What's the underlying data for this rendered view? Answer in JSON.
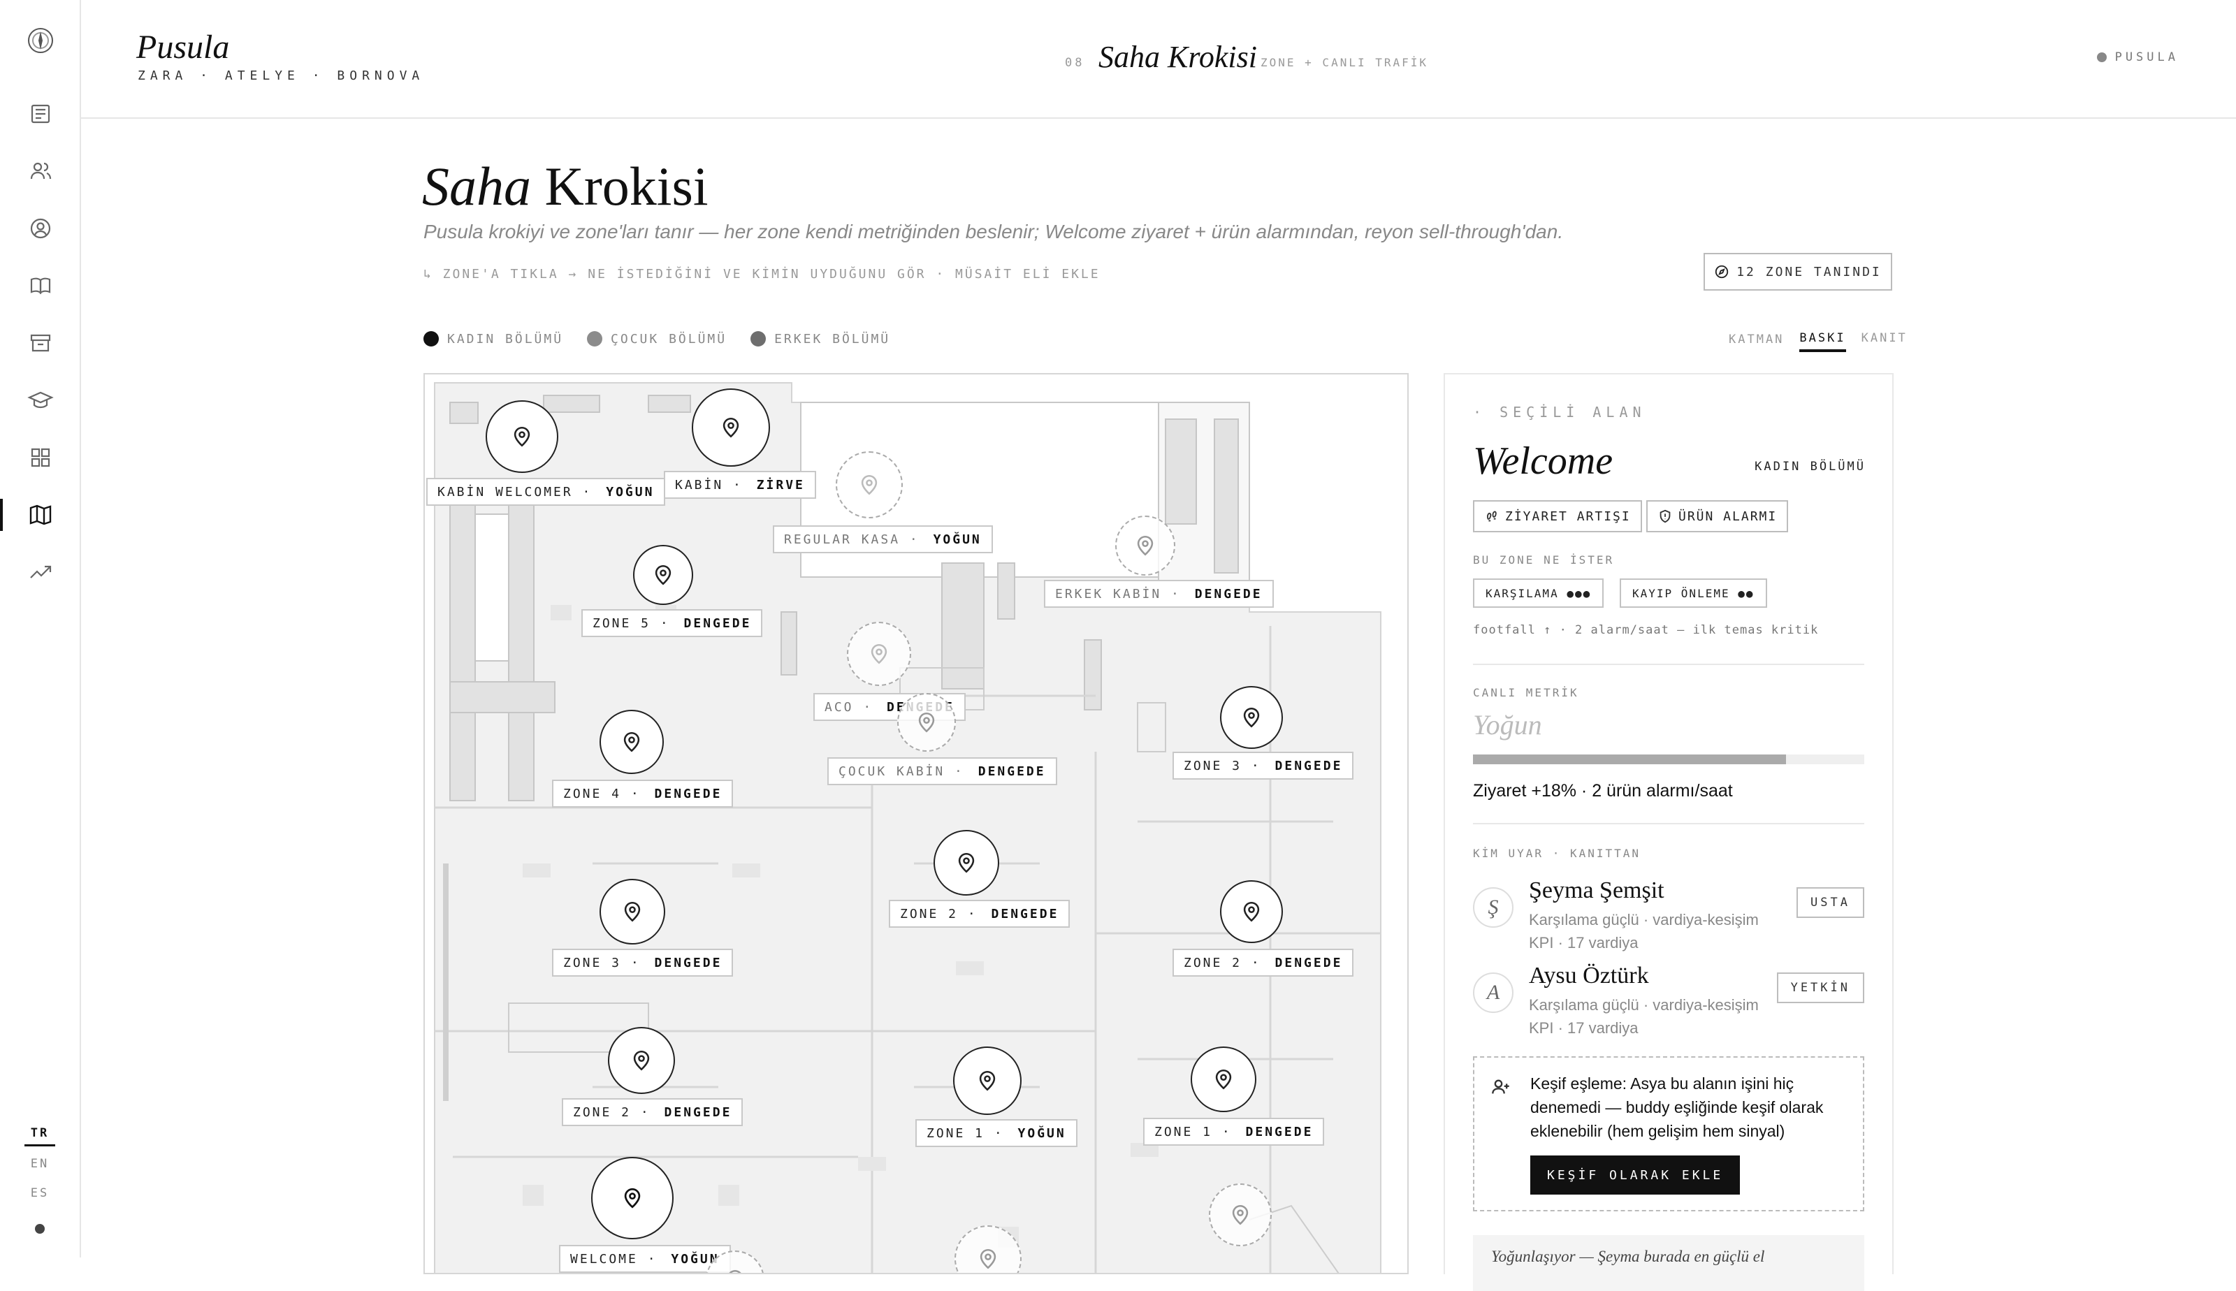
{
  "app": {
    "brand": "Pusula",
    "subtitle": "ZARA · ATELYE · BORNOVA"
  },
  "header": {
    "section_number": "08",
    "section_title": "Saha Krokisi",
    "section_subtitle": "ZONE + CANLI TRAFİK",
    "status_label": "PUSULA"
  },
  "sidebar": {
    "icons": [
      "compass-icon",
      "newspaper-icon",
      "users-icon",
      "user-circle-icon",
      "book-icon",
      "archive-icon",
      "graduation-cap-icon",
      "grid-icon",
      "map-icon",
      "trending-up-icon"
    ],
    "active": "map-icon",
    "languages": [
      "TR",
      "EN",
      "ES"
    ],
    "active_language": "TR"
  },
  "page": {
    "title_italic": "Saha",
    "title_rest": " Krokisi",
    "description": "Pusula krokiyi ve zone'ları tanır — her zone kendi metriğinden beslenir; Welcome ziyaret + ürün alarmından, reyon sell-through'dan.",
    "hint": "↳  ZONE'A TIKLA → NE İSTEDİĞİNİ VE KİMİN UYDUĞUNU GÖR · MÜSAİT ELİ EKLE",
    "zone_count_label": "12 ZONE TANINDI"
  },
  "legend": [
    {
      "label": "KADIN BÖLÜMÜ",
      "color": "#111111"
    },
    {
      "label": "ÇOCUK BÖLÜMÜ",
      "color": "#8c8c8c"
    },
    {
      "label": "ERKEK BÖLÜMÜ",
      "color": "#6e6e6e"
    }
  ],
  "layer_tabs": {
    "label": "KATMAN",
    "tabs": [
      "BASKI",
      "KANIT"
    ],
    "active": "BASKI"
  },
  "map": {
    "zones": [
      {
        "name": "KABİN WELCOMER",
        "state": "YOĞUN",
        "style": "solid"
      },
      {
        "name": "KABİN",
        "state": "ZİRVE",
        "style": "solid"
      },
      {
        "name": "REGULAR KASA",
        "state": "YOĞUN",
        "style": "dash"
      },
      {
        "name": "ERKEK KABİN",
        "state": "DENGEDE",
        "style": "dash"
      },
      {
        "name": "ZONE 5",
        "state": "DENGEDE",
        "style": "solid"
      },
      {
        "name": "ACO",
        "state": "DENGEDE",
        "style": "dash"
      },
      {
        "name": "ÇOCUK KABİN",
        "state": "DENGEDE",
        "style": "dash"
      },
      {
        "name": "ZONE 4",
        "state": "DENGEDE",
        "style": "solid"
      },
      {
        "name": "ZONE 3",
        "state": "DENGEDE",
        "style": "solid"
      },
      {
        "name": "ZONE 2",
        "state": "DENGEDE",
        "style": "solid"
      },
      {
        "name": "ZONE 3",
        "state": "DENGEDE",
        "style": "solid"
      },
      {
        "name": "ZONE 2",
        "state": "DENGEDE",
        "style": "solid"
      },
      {
        "name": "ZONE 2",
        "state": "DENGEDE",
        "style": "solid"
      },
      {
        "name": "ZONE 1",
        "state": "YOĞUN",
        "style": "solid"
      },
      {
        "name": "ZONE 1",
        "state": "DENGEDE",
        "style": "solid"
      },
      {
        "name": "WELCOME",
        "state": "YOĞUN",
        "style": "solid"
      }
    ]
  },
  "panel": {
    "eyebrow": "· SEÇİLİ ALAN",
    "title": "Welcome",
    "section": "KADIN BÖLÜMÜ",
    "chips": [
      {
        "label": "ZİYARET ARTIŞI",
        "icon": "footprints-icon"
      },
      {
        "label": "ÜRÜN ALARMI",
        "icon": "shield-alert-icon"
      }
    ],
    "needs_label": "BU ZONE NE İSTER",
    "needs": [
      "KARŞILAMA ●●●",
      "KAYIP ÖNLEME ●●"
    ],
    "footfall": "footfall ↑ · 2 alarm/saat — ilk temas kritik",
    "metric_label": "CANLI METRİK",
    "metric_level": "Yoğun",
    "metric_progress": 0.8,
    "metric_text": "Ziyaret +18% · 2 ürün alarmı/saat",
    "who_label": "KİM UYAR · KANITTAN",
    "people": [
      {
        "initial": "Ş",
        "name": "Şeyma Şemşit",
        "desc": "Karşılama güçlü · vardiya-kesişim KPI · 17 vardiya",
        "role": "USTA"
      },
      {
        "initial": "A",
        "name": "Aysu Öztürk",
        "desc": "Karşılama güçlü · vardiya-kesişim KPI · 17 vardiya",
        "role": "YETKİN"
      }
    ],
    "discover_text": "Keşif eşleme: Asya bu alanın işini hiç denemedi — buddy eşliğinde keşif olarak eklenebilir (hem gelişim hem sinyal)",
    "discover_button": "KEŞİF OLARAK EKLE",
    "quote": "Yoğunlaşıyor — Şeyma burada en güçlü el"
  }
}
